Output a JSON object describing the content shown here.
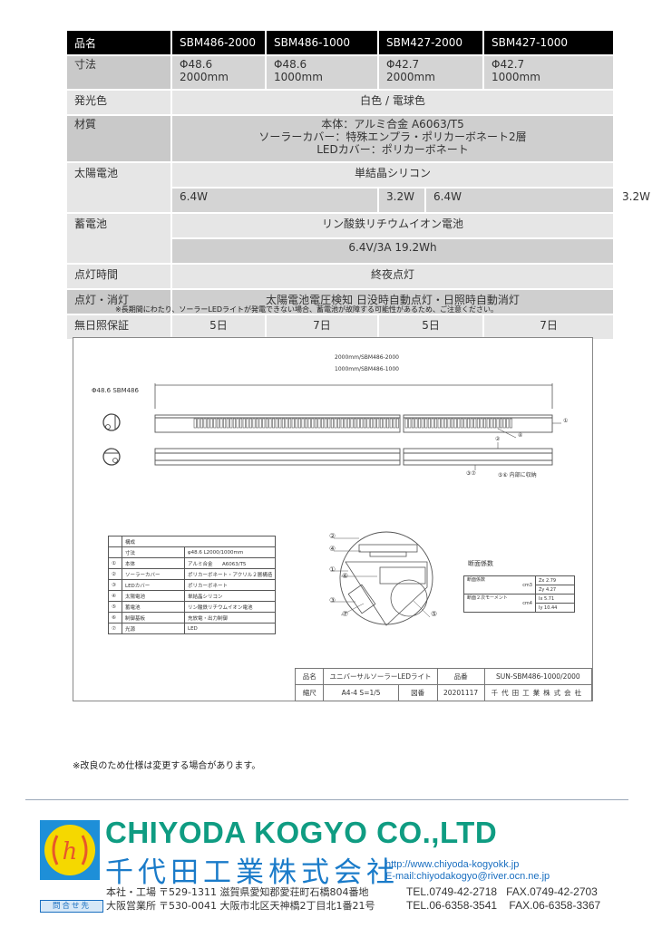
{
  "spec_table": {
    "header": {
      "label": "品名",
      "models": [
        "SBM486-2000",
        "SBM486-1000",
        "SBM427-2000",
        "SBM427-1000"
      ]
    },
    "dimensions": {
      "label": "寸法",
      "values": [
        [
          "Φ48.6",
          "2000mm"
        ],
        [
          "Φ48.6",
          "1000mm"
        ],
        [
          "Φ42.7",
          "2000mm"
        ],
        [
          "Φ42.7",
          "1000mm"
        ]
      ]
    },
    "light_color": {
      "label": "発光色",
      "value": "白色 / 電球色"
    },
    "material": {
      "label": "材質",
      "lines": [
        "本体：アルミ合金 A6063/T5",
        "ソーラーカバー：特殊エンプラ・ポリカーボネート2層",
        "LEDカバー：ポリカーボネート"
      ]
    },
    "solar": {
      "label": "太陽電池",
      "type": "単結晶シリコン",
      "watts": [
        "6.4W",
        "3.2W",
        "6.4W",
        "3.2W"
      ]
    },
    "battery": {
      "label": "蓄電池",
      "type": "リン酸鉄リチウムイオン電池",
      "spec": "6.4V/3A 19.2Wh"
    },
    "light_time": {
      "label": "点灯時間",
      "value": "終夜点灯"
    },
    "on_off": {
      "label": "点灯・消灯",
      "value": "太陽電池電圧検知 日没時自動点灯・日照時自動消灯"
    },
    "no_sun": {
      "label": "無日照保証",
      "values": [
        "5日",
        "7日",
        "5日",
        "7日"
      ]
    }
  },
  "note_battery": "※長期間にわたり、ソーラーLEDライトが発電できない場合、蓄電池が故障する可能性があるため、ご注意ください。",
  "drawing": {
    "model_label": "Φ48.6 SBM486",
    "length_1": "2000mm/SBM486-2000",
    "length_2": "1000mm/SBM486-1000",
    "callout_1": "①",
    "callout_2": "②",
    "callout_4": "④",
    "callout_37": "③⑦",
    "callout_56": "⑤⑥ 内部に収納",
    "parts": {
      "title": "構成",
      "dim_label": "寸法",
      "dim_value": "φ48.6 L2000/1000mm",
      "rows": [
        {
          "no": "①",
          "name": "本体",
          "value": "アルミ合金",
          "extra": "A6063/T5"
        },
        {
          "no": "②",
          "name": "ソーラーカバー",
          "value": "ポリカーボネート・アクリル２層構造"
        },
        {
          "no": "③",
          "name": "LEDカバー",
          "value": "ポリカーボネート"
        },
        {
          "no": "④",
          "name": "太陽電池",
          "value": "単結晶シリコン"
        },
        {
          "no": "⑤",
          "name": "蓄電池",
          "value": "リン酸鉄リチウムイオン電池"
        },
        {
          "no": "⑥",
          "name": "制御基板",
          "value": "充放電・出力制御"
        },
        {
          "no": "⑦",
          "name": "光源",
          "value": "LED"
        }
      ]
    },
    "cross_section_callouts": [
      "②",
      "④",
      "①",
      "⑥",
      "③",
      "⑦",
      "⑤"
    ],
    "section": {
      "title": "断面係数",
      "rows": [
        {
          "label": "断面係数",
          "unit": "cm3",
          "values": [
            "Zx 2.79",
            "Zy 4.27"
          ]
        },
        {
          "label": "断面２次モーメント",
          "unit": "cm4",
          "values": [
            "Ix 5.71",
            "Iy 10.44"
          ]
        }
      ]
    },
    "title_block": {
      "name_label": "品名",
      "name": "ユニバーサルソーラーLEDライト",
      "part_label": "品番",
      "part": "SUN-SBM486-1000/2000",
      "scale_label": "縮尺",
      "scale": "A4-4 S=1/5",
      "drawing_label": "図番",
      "drawing_no": "20201117",
      "company": "千代田工業株式会社"
    }
  },
  "note_change": "※改良のため仕様は変更する場合があります。",
  "footer": {
    "logo_glyph": "h",
    "company_en": "CHIYODA KOGYO CO.,LTD",
    "company_jp": "千代田工業株式会社",
    "url": "http://www.chiyoda-kogyokk.jp",
    "email": "E-mail:chiyodakogyo@river.ocn.ne.jp",
    "inquiry_label": "問合せ先",
    "offices": [
      {
        "name": "本社・工場",
        "address": "〒529-1311 滋賀県愛知郡愛荘町石橋804番地",
        "tel": "TEL.0749-42-2718",
        "fax": "FAX.0749-42-2703"
      },
      {
        "name": "大阪営業所",
        "address": "〒530-0041 大阪市北区天神橋2丁目北1番21号",
        "tel": "TEL.06-6358-3541",
        "fax": "FAX.06-6358-3367"
      }
    ],
    "colors": {
      "logo_bg": "#1e8fd8",
      "logo_circle": "#f5d800",
      "logo_mark": "#e8572a",
      "company_en": "#0f9c82",
      "company_jp": "#1a7bc9",
      "link": "#1a6fc0"
    }
  }
}
